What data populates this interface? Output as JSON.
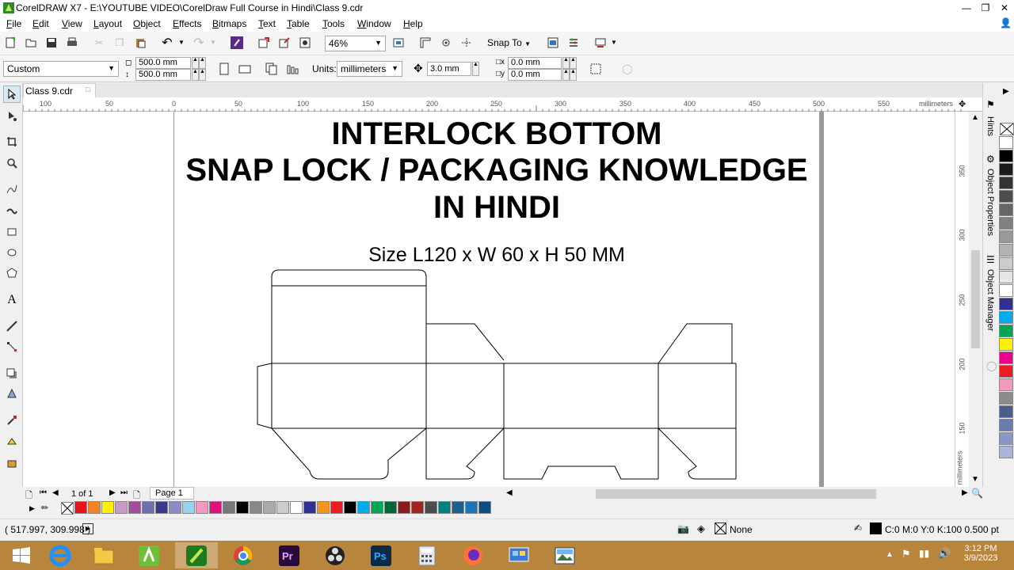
{
  "window": {
    "title": "CorelDRAW X7 - E:\\YOUTUBE VIDEO\\CorelDraw Full Course in Hindi\\Class 9.cdr",
    "controls": [
      "minimize",
      "restore",
      "close"
    ]
  },
  "menu": [
    "File",
    "Edit",
    "View",
    "Layout",
    "Object",
    "Effects",
    "Bitmaps",
    "Text",
    "Table",
    "Tools",
    "Window",
    "Help"
  ],
  "toolbar": {
    "zoom": "46%",
    "snap_to": "Snap To"
  },
  "property_bar": {
    "page_preset": "Custom",
    "width": "500.0 mm",
    "height": "500.0 mm",
    "units_label": "Units:",
    "units": "millimeters",
    "nudge": "3.0 mm",
    "dup_x": "0.0 mm",
    "dup_y": "0.0 mm"
  },
  "document_tab": "Class 9.cdr",
  "ruler": {
    "h_ticks": [
      "100",
      "50",
      "0",
      "50",
      "100",
      "150",
      "200",
      "250",
      "300",
      "350",
      "400",
      "450",
      "500",
      "550"
    ],
    "h_unit": "millimeters",
    "v_ticks": [
      "350",
      "300",
      "250",
      "200",
      "150"
    ],
    "v_unit": "millimeters"
  },
  "canvas": {
    "heading_line1": "INTERLOCK BOTTOM",
    "heading_line2": "SNAP LOCK / PACKAGING KNOWLEDGE",
    "heading_line3": "IN HINDI",
    "size_text": "Size L120 x W 60 x H 50 MM"
  },
  "dockers": [
    "Hints",
    "Object Properties",
    "Object Manager"
  ],
  "page_nav": {
    "page_count": "1 of 1",
    "page_tab": "Page 1"
  },
  "palette_bottom": [
    "#e8141b",
    "#f58220",
    "#fff200",
    "#c89ac8",
    "#a14d9c",
    "#6d6fb3",
    "#3a3a8a",
    "#8b8bc7",
    "#9ad0f0",
    "#f49ac1",
    "#e0107a",
    "#777777",
    "#000000",
    "#888888",
    "#aaaaaa",
    "#cccccc",
    "#ffffff",
    "#2e3192",
    "#f7941d",
    "#ed1c24",
    "#000000",
    "#00aeef",
    "#00a651",
    "#006838",
    "#8b1a1a",
    "#a3231f",
    "#4d4d4d",
    "#008080",
    "#1f5f8b",
    "#1b75bb",
    "#0f4c81"
  ],
  "palette_right": [
    "#ffffff",
    "#000000",
    "#1a1a1a",
    "#333333",
    "#4d4d4d",
    "#666666",
    "#808080",
    "#999999",
    "#b3b3b3",
    "#cccccc",
    "#e6e6e6",
    "#ffffff",
    "#2e3192",
    "#00aeef",
    "#00a651",
    "#fff200",
    "#ec008c",
    "#ed1c24",
    "#f49ac1",
    "#8b8b8b",
    "#4d5d8b",
    "#6a7bb0",
    "#8896c8",
    "#aab4dd"
  ],
  "status": {
    "coords": "( 517.997, 309.998 )",
    "fill": "None",
    "outline": "C:0 M:0 Y:0 K:100  0.500 pt"
  },
  "taskbar": {
    "apps": [
      "start",
      "internet-explorer",
      "file-explorer",
      "coreldraw-launcher",
      "coreldraw",
      "chrome",
      "premiere",
      "obs",
      "photoshop",
      "calculator",
      "firefox",
      "control-panel",
      "photos"
    ],
    "time": "3:12 PM",
    "date": "3/9/2023"
  }
}
